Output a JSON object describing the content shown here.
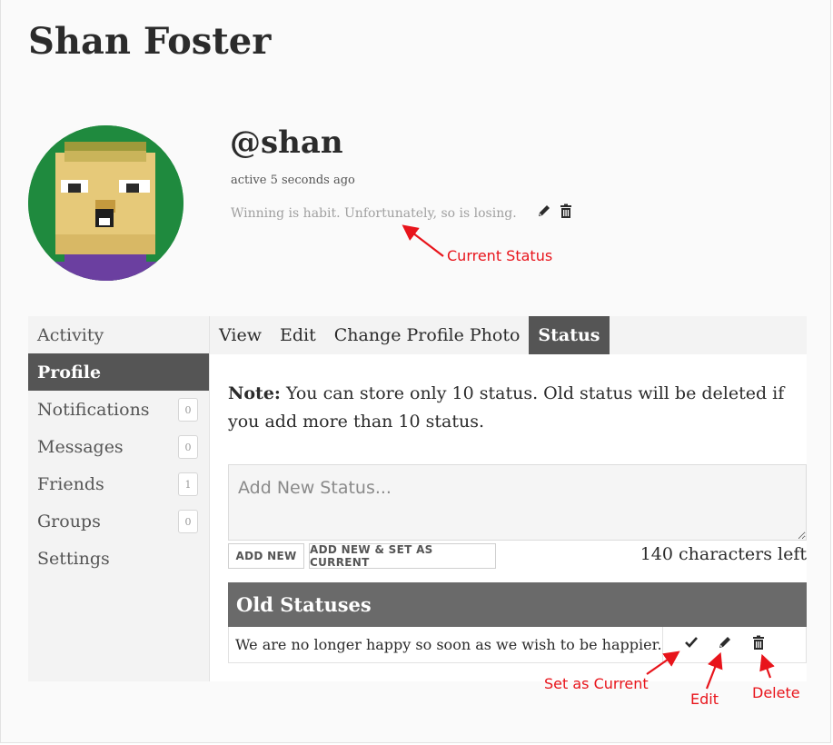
{
  "page": {
    "title": "Shan Foster"
  },
  "profile": {
    "handle": "@shan",
    "last_active": "active 5 seconds ago",
    "current_status": "Winning is habit. Unfortunately, so is losing.",
    "avatar_icon": "pixel-avatar-icon"
  },
  "sidebar": {
    "items": [
      {
        "label": "Activity"
      },
      {
        "label": "Profile",
        "active": true
      },
      {
        "label": "Notifications",
        "count": "0"
      },
      {
        "label": "Messages",
        "count": "0"
      },
      {
        "label": "Friends",
        "count": "1"
      },
      {
        "label": "Groups",
        "count": "0"
      },
      {
        "label": "Settings"
      }
    ]
  },
  "tabs": [
    {
      "label": "View"
    },
    {
      "label": "Edit"
    },
    {
      "label": "Change Profile Photo"
    },
    {
      "label": "Status",
      "active": true
    }
  ],
  "status_form": {
    "note_bold": "Note:",
    "note_text": " You can store only 10 status. Old status will be deleted if you add more than 10 status.",
    "placeholder": "Add New Status...",
    "add_button": "ADD NEW",
    "add_current_button": "ADD NEW & SET AS CURRENT",
    "chars_left": "140 characters left"
  },
  "old_statuses": {
    "header": "Old Statuses",
    "rows": [
      {
        "text": "We are no longer happy so soon as we wish to be happier."
      }
    ]
  },
  "annotations": {
    "current_status": "Current Status",
    "set_as_current": "Set as Current",
    "edit": "Edit",
    "delete": "Delete"
  },
  "colors": {
    "accent_dark": "#555555",
    "header_gray": "#6a6a6a",
    "annotation_red": "#e8141b",
    "avatar_green": "#1f8a3e"
  }
}
